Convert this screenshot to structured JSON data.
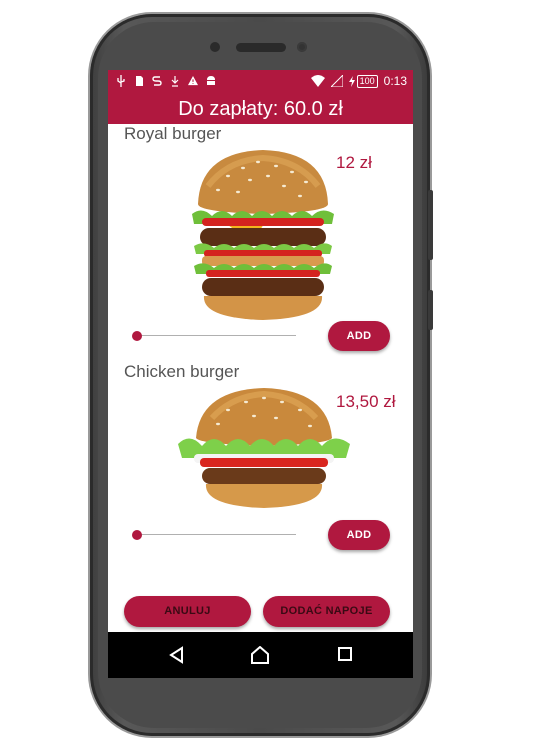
{
  "status_bar": {
    "battery": "100",
    "time": "0:13"
  },
  "header": {
    "title": "Do zapłaty: 60.0 zł"
  },
  "products": [
    {
      "name": "Royal burger",
      "price": "12 zł",
      "add_label": "ADD",
      "quantity_fraction": 0
    },
    {
      "name": "Chicken burger",
      "price": "13,50 zł",
      "add_label": "ADD",
      "quantity_fraction": 0
    }
  ],
  "footer": {
    "cancel_label": "ANULUJ",
    "drinks_label": "DODAĆ NAPOJE"
  },
  "colors": {
    "accent": "#b0183f",
    "nav_bar": "#000000"
  },
  "icons": [
    "usb-icon",
    "sim-icon",
    "s-icon",
    "download-icon",
    "warning-icon",
    "android-icon",
    "wifi-icon",
    "signal-icon",
    "battery-icon",
    "back-icon",
    "home-icon",
    "recents-icon"
  ]
}
